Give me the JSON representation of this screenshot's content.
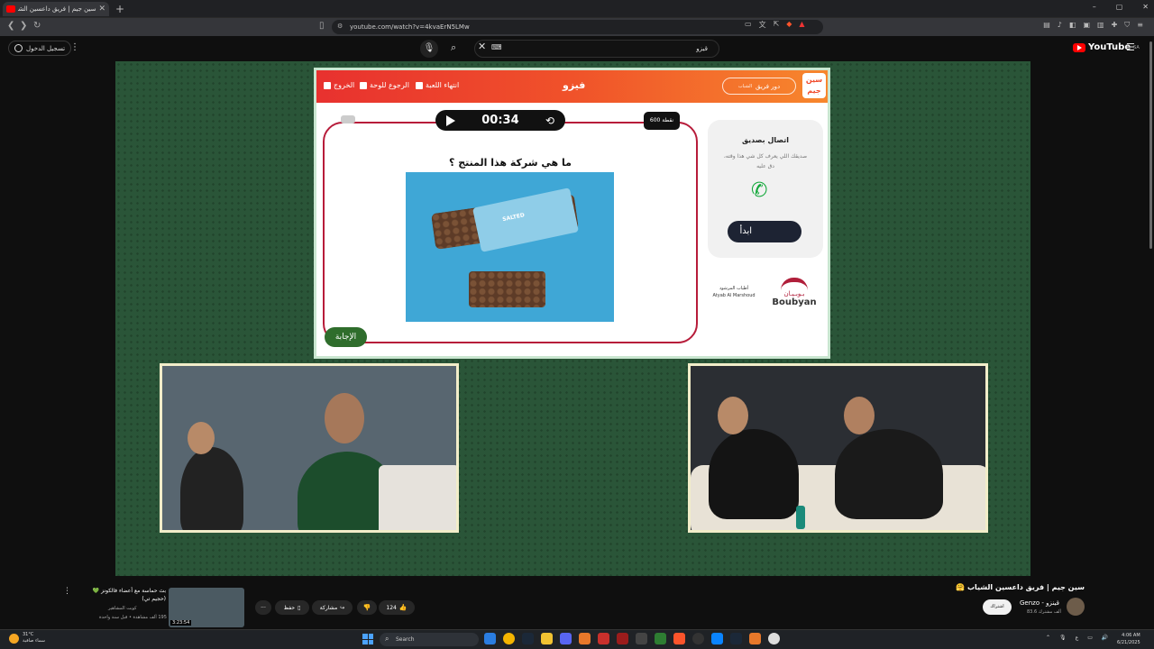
{
  "browser": {
    "tab_title": "سين جيم | فريق داعسين الشياب",
    "tab_close": "✕",
    "new_tab": "+",
    "url": "youtube.com/watch?v=4kvaErN5LMw",
    "window_controls": [
      "–",
      "▢",
      "✕"
    ]
  },
  "youtube": {
    "sign_in": "تسجيل الدخول",
    "search_value": "قيزو",
    "logo_text": "YouTube",
    "region": "SA"
  },
  "game": {
    "title": "فيزو",
    "exit_label": "الخروج",
    "board_label": "الرجوع للوحة",
    "end_game_label": "انتهاء اللعبة",
    "turn_label": "دور فريق",
    "turn_sub": "الشباب",
    "logo_text": "سين جيم",
    "timer": "00:34",
    "points": "600 نقطة",
    "question": "ما هي شركة هذا المنتج ؟",
    "product_text": "SALTED",
    "answer_button": "الإجابة",
    "call_friend_title": "اتصال بصديق",
    "call_friend_desc": "صديقك اللي يعرف كل شي هذا وقته، دق عليه",
    "start_button": "ابدأ",
    "sponsor_main_ar": "بـوبـيـان",
    "sponsor_main_en": "Boubyan",
    "sponsor_second_ar": "أطياب المرشود",
    "sponsor_second_en": "Atyab Al Marshoud"
  },
  "video_info": {
    "title": "سين جيم | فريق داعسين الشياب 🤗",
    "channel": "Genzo - قينزو",
    "subscribers": "83.6 ألف مشترك",
    "subscribe_label": "اشتراك",
    "likes": "124",
    "share_label": "مشاركة",
    "save_label": "حفظ",
    "more": "···"
  },
  "recommendation": {
    "title": "بث حماسة مع أعضاء فالكونز 💚 (حجيم تي)",
    "channel": "كوبت المشاهير",
    "meta": "195 ألف مشاهدة • قبل سنة واحدة",
    "duration": "3:23:54"
  },
  "taskbar": {
    "weather_temp": "31°C",
    "weather_desc": "سماء صافية",
    "search_label": "Search",
    "time": "4:06 AM",
    "date": "6/21/2025"
  }
}
